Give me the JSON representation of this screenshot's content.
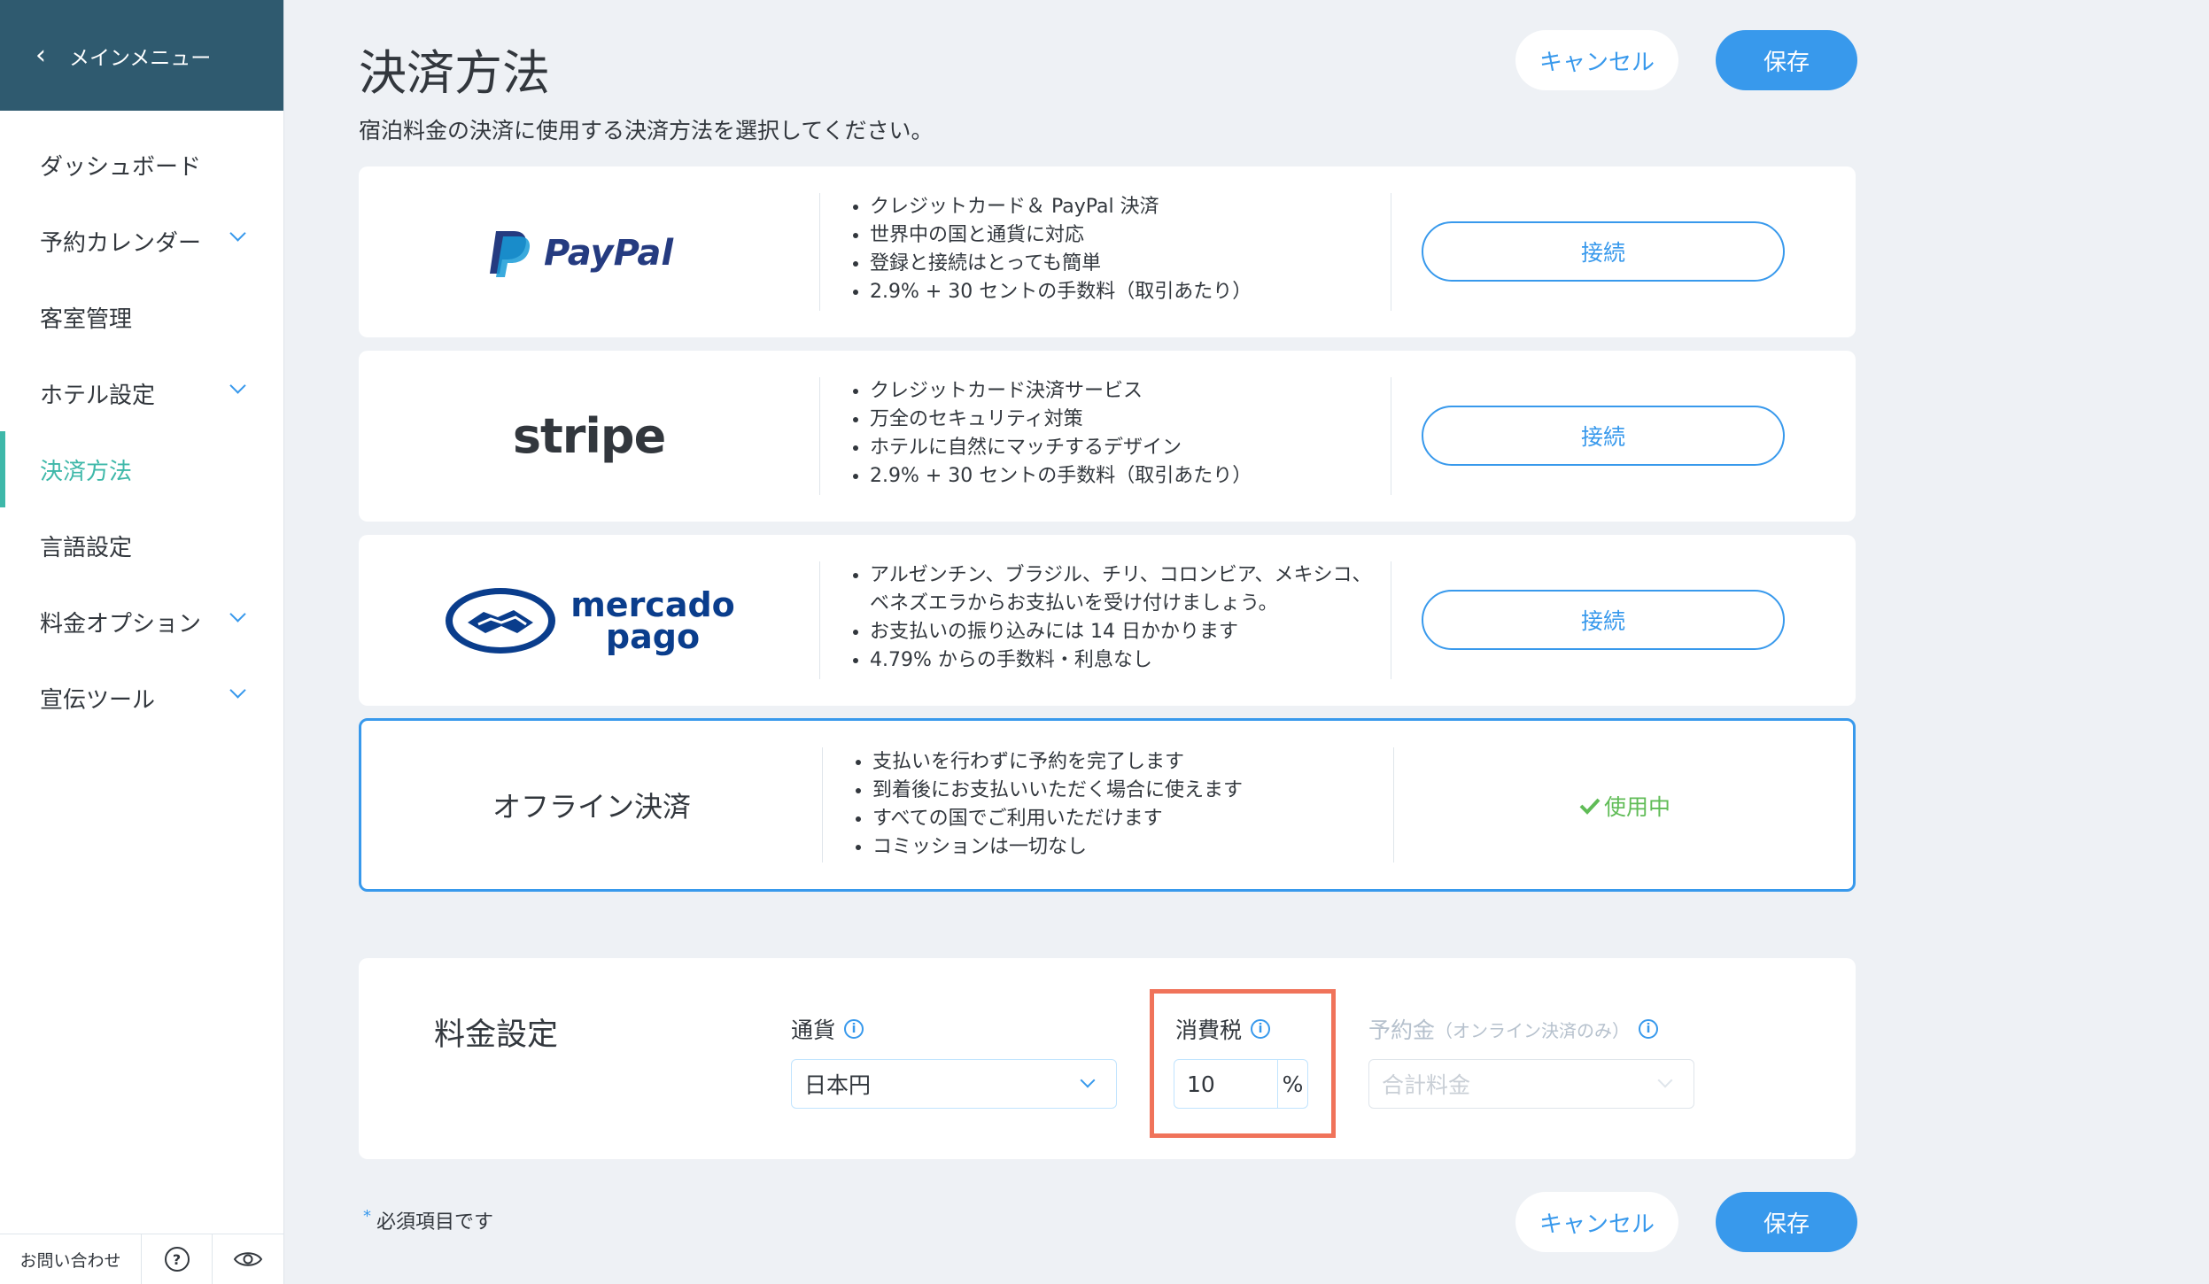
{
  "sidebar": {
    "back_label": "メインメニュー",
    "items": [
      {
        "label": "ダッシュボード",
        "has_submenu": false
      },
      {
        "label": "予約カレンダー",
        "has_submenu": true
      },
      {
        "label": "客室管理",
        "has_submenu": false
      },
      {
        "label": "ホテル設定",
        "has_submenu": true
      },
      {
        "label": "決済方法",
        "has_submenu": false,
        "active": true
      },
      {
        "label": "言語設定",
        "has_submenu": false
      },
      {
        "label": "料金オプション",
        "has_submenu": true
      },
      {
        "label": "宣伝ツール",
        "has_submenu": true
      }
    ],
    "footer": {
      "contact_label": "お問い合わせ"
    }
  },
  "header": {
    "title": "決済方法",
    "subtitle": "宿泊料金の決済に使用する決済方法を選択してください。",
    "cancel_label": "キャンセル",
    "save_label": "保存"
  },
  "providers": [
    {
      "logo_text": "PayPal",
      "features": [
        "クレジットカード＆ PayPal 決済",
        "世界中の国と通貨に対応",
        "登録と接続はとっても簡単",
        "2.9% + 30 セントの手数料（取引あたり）"
      ],
      "action_label": "接続"
    },
    {
      "logo_text": "stripe",
      "features": [
        "クレジットカード決済サービス",
        "万全のセキュリティ対策",
        "ホテルに自然にマッチするデザイン",
        "2.9% + 30 セントの手数料（取引あたり）"
      ],
      "action_label": "接続"
    },
    {
      "logo_text_1": "mercado",
      "logo_text_2": "pago",
      "features": [
        "アルゼンチン、ブラジル、チリ、コロンビア、メキシコ、ベネズエラからお支払いを受け付けましょう。",
        "お支払いの振り込みには 14 日かかります",
        "4.79% からの手数料・利息なし"
      ],
      "action_label": "接続"
    },
    {
      "title": "オフライン決済",
      "features": [
        "支払いを行わずに予約を完了します",
        "到着後にお支払いいただく場合に使えます",
        "すべての国でご利用いただけます",
        "コミッションは一切なし"
      ],
      "status_label": "使用中"
    }
  ],
  "pricing": {
    "title": "料金設定",
    "currency": {
      "label": "通貨",
      "value": "日本円"
    },
    "tax": {
      "label": "消費税",
      "value": "10",
      "suffix": "%"
    },
    "deposit": {
      "label": "予約金",
      "sublabel": "（オンライン決済のみ）",
      "placeholder": "合計料金"
    }
  },
  "footer": {
    "required_note": "必須項目です",
    "cancel_label": "キャンセル",
    "save_label": "保存"
  },
  "colors": {
    "accent": "#3899ec",
    "sidebar_header": "#2f5a6f",
    "active_nav": "#3eb8a9",
    "success": "#60bc57",
    "highlight": "#f0735a"
  }
}
